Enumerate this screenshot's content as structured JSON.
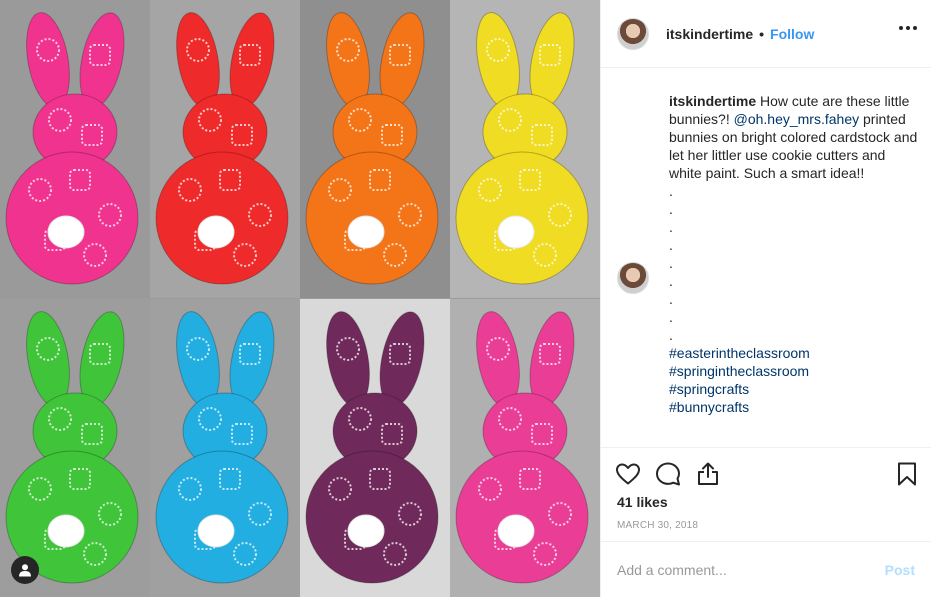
{
  "header": {
    "username": "itskindertime",
    "separator": "•",
    "follow_label": "Follow"
  },
  "caption": {
    "username": "itskindertime",
    "text_before_mention": "How cute are these little bunnies?! ",
    "mention": "@oh.hey_mrs.fahey",
    "text_after_mention": " printed bunnies on bright colored cardstock and let her littler use cookie cutters and white paint. Such a smart idea!!",
    "dots": [
      ".",
      ".",
      ".",
      ".",
      ".",
      ".",
      ".",
      ".",
      "."
    ],
    "hashtags": [
      "#easterintheclassroom",
      "#springintheclassroom",
      "#springcrafts",
      "#bunnycrafts"
    ]
  },
  "stats": {
    "likes": "41 likes",
    "date": "MARCH 30, 2018"
  },
  "comment": {
    "placeholder": "Add a comment...",
    "post_label": "Post"
  },
  "icons": {
    "like": "heart-icon",
    "comment": "comment-bubble-icon",
    "share": "share-icon",
    "save": "bookmark-icon",
    "more": "more-options-icon",
    "tag": "user-tag-icon"
  },
  "image": {
    "bunny_colors": [
      "#f0338f",
      "#ef2a2a",
      "#f47418",
      "#f0dc22",
      "#3fc43a",
      "#22aee0",
      "#6f2a5b",
      "#ea3d96"
    ],
    "panel_backgrounds": [
      "#9a9a9a",
      "#a5a5a5",
      "#8f8f8f",
      "#b5b5b5",
      "#9d9d9d",
      "#a0a0a0",
      "#d9d9d9",
      "#b0b0b0"
    ]
  },
  "colors": {
    "follow": "#3897f0",
    "link": "#003569",
    "muted": "#999999",
    "post_disabled": "#b2dffc"
  }
}
